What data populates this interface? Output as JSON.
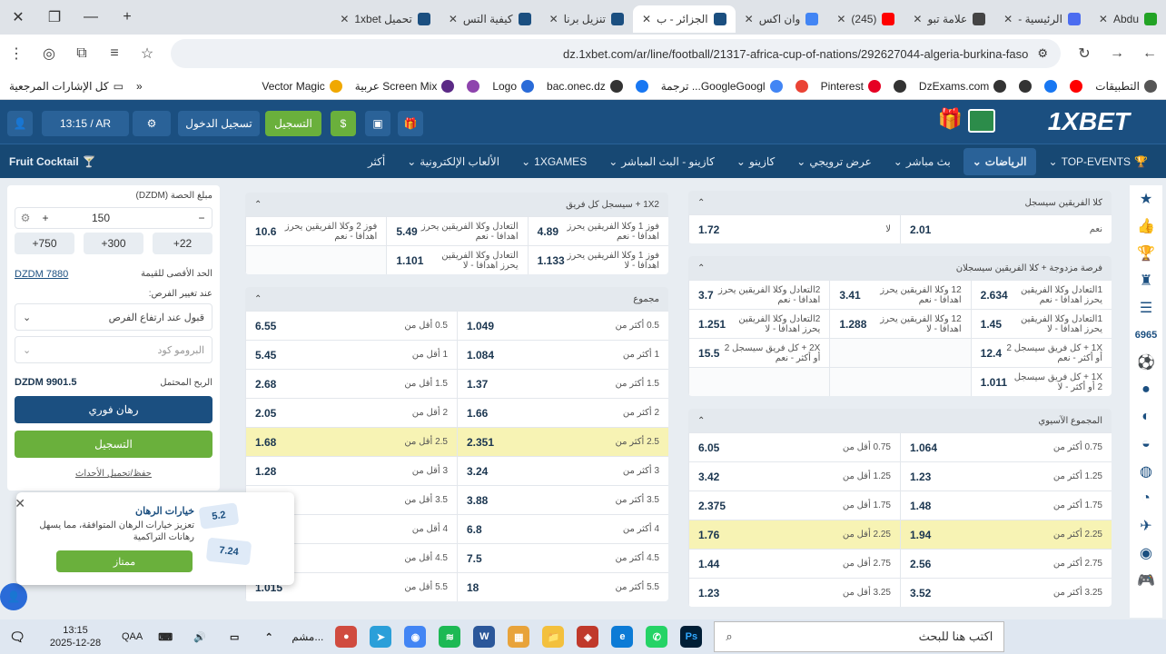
{
  "browser": {
    "tabs": [
      {
        "label": "Abdu",
        "color": "#22a325",
        "icon": "k-icon"
      },
      {
        "label": "الرئيسية -",
        "color": "#4b6cf0",
        "icon": "globe-icon"
      },
      {
        "label": "علامة تبو",
        "color": "#444444",
        "icon": "github-icon"
      },
      {
        "label": "(245) ",
        "color": "#ff0000",
        "icon": "youtube-icon"
      },
      {
        "label": "وان اكس",
        "color": "#4285f4",
        "icon": "google-icon"
      },
      {
        "label": "الجزائر - ب",
        "color": "#1b4f80",
        "icon": "1xbet-icon",
        "active": true
      },
      {
        "label": "تنزيل برنا",
        "color": "#1b4f80",
        "icon": "1xbet-icon"
      },
      {
        "label": "كيفية التس",
        "color": "#1b4f80",
        "icon": "1xbet-icon"
      },
      {
        "label": "تحميل 1xbet",
        "color": "#1b4f80",
        "icon": "1xbet-icon"
      }
    ],
    "url": "dz.1xbet.com/ar/line/football/21317-africa-cup-of-nations/292627044-algeria-burkina-faso",
    "bookmarks": [
      {
        "label": "التطبيقات",
        "color": "#555555"
      },
      {
        "label": "",
        "color": "#ff0000"
      },
      {
        "label": "",
        "color": "#1877f2"
      },
      {
        "label": "",
        "color": "#333333"
      },
      {
        "label": "DzExams.com",
        "color": "#333333"
      },
      {
        "label": "",
        "color": "#333333"
      },
      {
        "label": "Pinterest",
        "color": "#e60023"
      },
      {
        "label": "",
        "color": "#ea4335"
      },
      {
        "label": "GoogleGoogl... ترجمة",
        "color": "#4285f4"
      },
      {
        "label": "",
        "color": "#1877f2"
      },
      {
        "label": "bac.onec.dz",
        "color": "#333333"
      },
      {
        "label": "Logo",
        "color": "#2a6bd8"
      },
      {
        "label": "",
        "color": "#8e44ad"
      },
      {
        "label": "Screen Mix عربية",
        "color": "#5b2a86"
      },
      {
        "label": "Vector Magic",
        "color": "#f0a800"
      }
    ],
    "all_bookmarks": "كل الإشارات المرجعية"
  },
  "site": {
    "logo": "1XBET",
    "register": "التسجيل",
    "login": "تسجيل الدخول",
    "time": "13:15 / AR",
    "nav": [
      "TOP-EVENTS",
      "الرياضات",
      "بث مباشر",
      "عرض ترويجي",
      "كازينو",
      "كازينو - البث المباشر",
      "1XGAMES",
      "الألعاب الإلكترونية",
      "أكثر"
    ],
    "nav_extra": "Fruit Cocktail"
  },
  "betslip": {
    "amount_label": "مبلغ الحصة (DZDM)",
    "amount": "150",
    "chips": [
      "22+",
      "300+",
      "750+"
    ],
    "max_label": "الحد الأقصى للقيمة",
    "max_value": "DZDM 7880",
    "odds_change_label": "عند تغيير الفرص:",
    "odds_option": "قبول عند ارتفاع الفرص",
    "promo": "البرومو كود",
    "win_label": "الربح المحتمل",
    "win_value": "DZDM 9901.5",
    "quick_bet": "رهان فوري",
    "register": "التسجيل",
    "save": "حفظ/تحميل الأحداث"
  },
  "popup": {
    "title": "خيارات الرهان",
    "text": "تعزيز خيارات الرهان المتوافقة، مما يسهل رهانات التراكمية",
    "button": "ممتاز",
    "badge1": "5.2",
    "badge2": "7.24"
  },
  "markets_left": [
    {
      "title": "1X2 + سيسجل كل فريق",
      "rows": [
        {
          "cells": [
            {
              "l": "فوز 1 وكلا الفريقين يحرز اهدافا - نعم",
              "o": "4.89"
            },
            {
              "l": "التعادل وكلا الفريقين يحرز اهدافا - نعم",
              "o": "5.49"
            },
            {
              "l": "فوز 2 وكلا الفريقين يحرز اهدافا - نعم",
              "o": "10.6"
            }
          ]
        },
        {
          "cells": [
            {
              "l": "فوز 1 وكلا الفريقين يحرز اهدافا - لا",
              "o": "1.133"
            },
            {
              "l": "التعادل وكلا الفريقين يحرز اهدافا - لا",
              "o": "1.101"
            },
            {
              "l": "",
              "o": ""
            }
          ]
        }
      ]
    },
    {
      "title": "مجموع",
      "rows": [
        {
          "cells": [
            {
              "l": "0.5 أكثر من",
              "o": "1.049"
            },
            {
              "l": "0.5 أقل من",
              "o": "6.55"
            }
          ]
        },
        {
          "cells": [
            {
              "l": "1 أكثر من",
              "o": "1.084"
            },
            {
              "l": "1 أقل من",
              "o": "5.45"
            }
          ]
        },
        {
          "cells": [
            {
              "l": "1.5 أكثر من",
              "o": "1.37"
            },
            {
              "l": "1.5 أقل من",
              "o": "2.68"
            }
          ]
        },
        {
          "cells": [
            {
              "l": "2 أكثر من",
              "o": "1.66"
            },
            {
              "l": "2 أقل من",
              "o": "2.05"
            }
          ]
        },
        {
          "hl": true,
          "cells": [
            {
              "l": "2.5 أكثر من",
              "o": "2.351"
            },
            {
              "l": "2.5 أقل من",
              "o": "1.68"
            }
          ]
        },
        {
          "cells": [
            {
              "l": "3 أكثر من",
              "o": "3.24"
            },
            {
              "l": "3 أقل من",
              "o": "1.28"
            }
          ]
        },
        {
          "cells": [
            {
              "l": "3.5 أكثر من",
              "o": "3.88"
            },
            {
              "l": "3.5 أقل من",
              "o": ""
            }
          ]
        },
        {
          "cells": [
            {
              "l": "4 أكثر من",
              "o": "6.8"
            },
            {
              "l": "4 أقل من",
              "o": ""
            }
          ]
        },
        {
          "cells": [
            {
              "l": "4.5 أكثر من",
              "o": "7.5"
            },
            {
              "l": "4.5 أقل من",
              "o": ""
            }
          ]
        },
        {
          "cells": [
            {
              "l": "5.5 أكثر من",
              "o": "18"
            },
            {
              "l": "5.5 أقل من",
              "o": "1.015"
            }
          ]
        }
      ]
    }
  ],
  "markets_right": [
    {
      "title": "كلا الفريقين سيسجل",
      "rows": [
        {
          "cells": [
            {
              "l": "نعم",
              "o": "2.01"
            },
            {
              "l": "لا",
              "o": "1.72"
            }
          ]
        }
      ]
    },
    {
      "title": "فرصة مزدوجة + كلا الفريقين سيسجلان",
      "rows": [
        {
          "cells": [
            {
              "l": "1التعادل وكلا الفريقين يحرز اهدافا - نعم",
              "o": "2.634"
            },
            {
              "l": "12 وكلا الفريقين يحرز اهدافا - نعم",
              "o": "3.41"
            },
            {
              "l": "2التعادل وكلا الفريقين يحرز اهدافا - نعم",
              "o": "3.7"
            }
          ]
        },
        {
          "cells": [
            {
              "l": "1التعادل وكلا الفريقين يحرز اهدافا - لا",
              "o": "1.45"
            },
            {
              "l": "12 وكلا الفريقين يحرز اهدافا - لا",
              "o": "1.288"
            },
            {
              "l": "2التعادل وكلا الفريقين يحرز اهدافا - لا",
              "o": "1.251"
            }
          ]
        },
        {
          "cells": [
            {
              "l": "1X + كل فريق سيسجل 2 أو أكثر - نعم",
              "o": "12.4"
            },
            {
              "l": "",
              "o": ""
            },
            {
              "l": "2X + كل فريق سيسجل 2 أو أكثر - نعم",
              "o": "15.5"
            }
          ]
        },
        {
          "cells": [
            {
              "l": "1X + كل فريق سيسجل 2 أو أكثر - لا",
              "o": "1.011"
            },
            {
              "l": "",
              "o": ""
            },
            {
              "l": "",
              "o": ""
            }
          ]
        }
      ]
    },
    {
      "title": "المجموع الآسيوي",
      "rows": [
        {
          "cells": [
            {
              "l": "0.75 أكثر من",
              "o": "1.064"
            },
            {
              "l": "0.75 أقل من",
              "o": "6.05"
            }
          ]
        },
        {
          "cells": [
            {
              "l": "1.25 أكثر من",
              "o": "1.23"
            },
            {
              "l": "1.25 أقل من",
              "o": "3.42"
            }
          ]
        },
        {
          "cells": [
            {
              "l": "1.75 أكثر من",
              "o": "1.48"
            },
            {
              "l": "1.75 أقل من",
              "o": "2.375"
            }
          ]
        },
        {
          "hl": true,
          "cells": [
            {
              "l": "2.25 أكثر من",
              "o": "1.94"
            },
            {
              "l": "2.25 أقل من",
              "o": "1.76"
            }
          ]
        },
        {
          "cells": [
            {
              "l": "2.75 أكثر من",
              "o": "2.56"
            },
            {
              "l": "2.75 أقل من",
              "o": "1.44"
            }
          ]
        },
        {
          "cells": [
            {
              "l": "3.25 أكثر من",
              "o": "3.52"
            },
            {
              "l": "3.25 أقل من",
              "o": "1.23"
            }
          ]
        }
      ]
    }
  ],
  "rightbar": {
    "counter": "6965"
  },
  "taskbar": {
    "search": "اكتب هنا للبحث",
    "time": "13:15",
    "date": "2025-12-28",
    "lang": "QAA",
    "minimized": "مشم..."
  }
}
